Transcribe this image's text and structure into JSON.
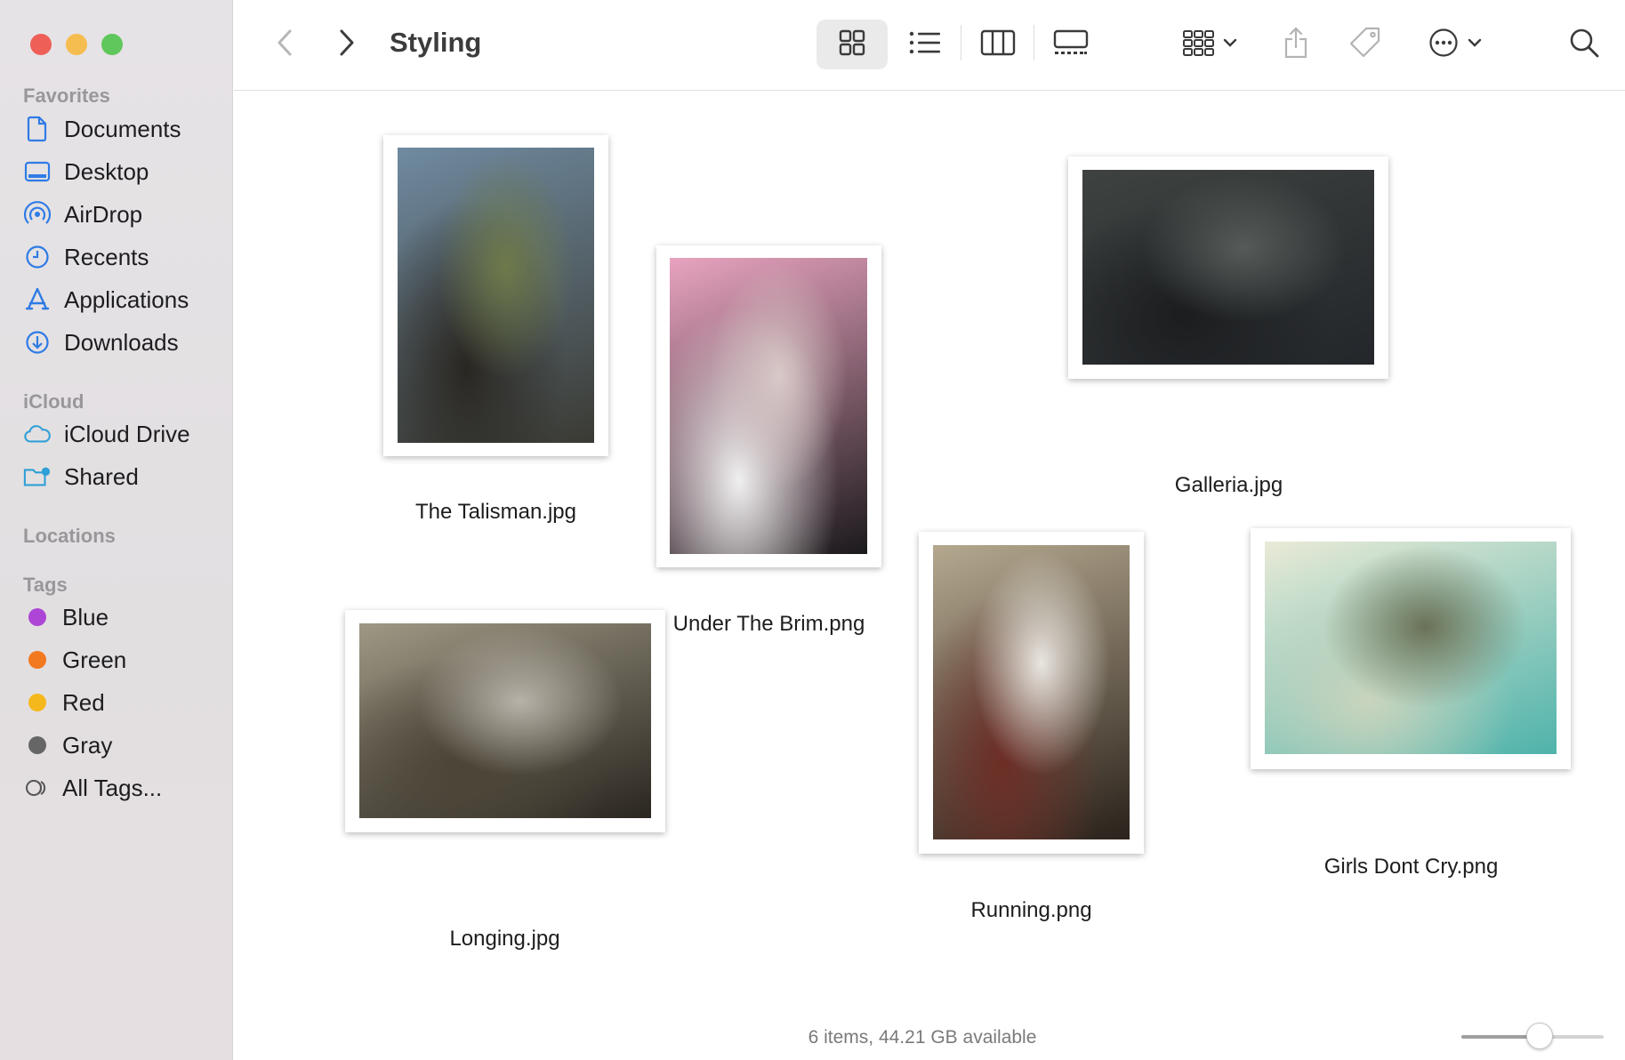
{
  "window": {
    "traffic_lights": {
      "close": "#ee5f57",
      "minimize": "#f5bd4f",
      "zoom": "#5fc75b"
    }
  },
  "sidebar": {
    "favorites_title": "Favorites",
    "favorites": [
      {
        "label": "Documents",
        "icon": "document-icon"
      },
      {
        "label": "Desktop",
        "icon": "desktop-icon"
      },
      {
        "label": "AirDrop",
        "icon": "airdrop-icon"
      },
      {
        "label": "Recents",
        "icon": "clock-icon"
      },
      {
        "label": "Applications",
        "icon": "applications-icon"
      },
      {
        "label": "Downloads",
        "icon": "download-icon"
      }
    ],
    "icloud_title": "iCloud",
    "icloud": [
      {
        "label": "iCloud Drive",
        "icon": "cloud-icon"
      },
      {
        "label": "Shared",
        "icon": "shared-folder-icon"
      }
    ],
    "locations_title": "Locations",
    "tags_title": "Tags",
    "tags": [
      {
        "label": "Blue",
        "color": "#ad46d6"
      },
      {
        "label": "Green",
        "color": "#f2791f"
      },
      {
        "label": "Red",
        "color": "#f5b81c"
      },
      {
        "label": "Gray",
        "color": "#666666"
      },
      {
        "label": "All Tags...",
        "icon": "all-tags-icon"
      }
    ],
    "accent_color": "#2f7be5"
  },
  "toolbar": {
    "title": "Styling",
    "back": "chevron-left-icon",
    "forward": "chevron-right-icon",
    "views": [
      "icon-view",
      "list-view",
      "column-view",
      "gallery-view"
    ],
    "active_view": "icon-view",
    "group": "group-icon",
    "share": "share-icon",
    "tag": "tag-icon",
    "more": "ellipsis-circle-icon",
    "search": "search-icon"
  },
  "files": [
    {
      "name": "The Talisman.jpg",
      "palette": [
        "#6f8aa0",
        "#3a3a33",
        "#6e7a4a",
        "#2a2722"
      ]
    },
    {
      "name": "Under The Brim.png",
      "palette": [
        "#e8a3bf",
        "#1c1a1c",
        "#d9c9c8",
        "#f0f0f0"
      ]
    },
    {
      "name": "Galleria.jpg",
      "palette": [
        "#3e4240",
        "#23262a",
        "#565b59",
        "#1b1d1f"
      ]
    },
    {
      "name": "Longing.jpg",
      "palette": [
        "#9e9884",
        "#2a2620",
        "#b7b2a8",
        "#4b4537"
      ]
    },
    {
      "name": "Running.png",
      "palette": [
        "#b5a88f",
        "#2a221b",
        "#e9e6e0",
        "#6d2e26"
      ]
    },
    {
      "name": "Girls Dont Cry.png",
      "palette": [
        "#e9ead6",
        "#4fb3ab",
        "#6a7257",
        "#c9d4bd"
      ]
    }
  ],
  "status": {
    "text": "6 items, 44.21 GB available",
    "zoom_level": 0.55
  }
}
